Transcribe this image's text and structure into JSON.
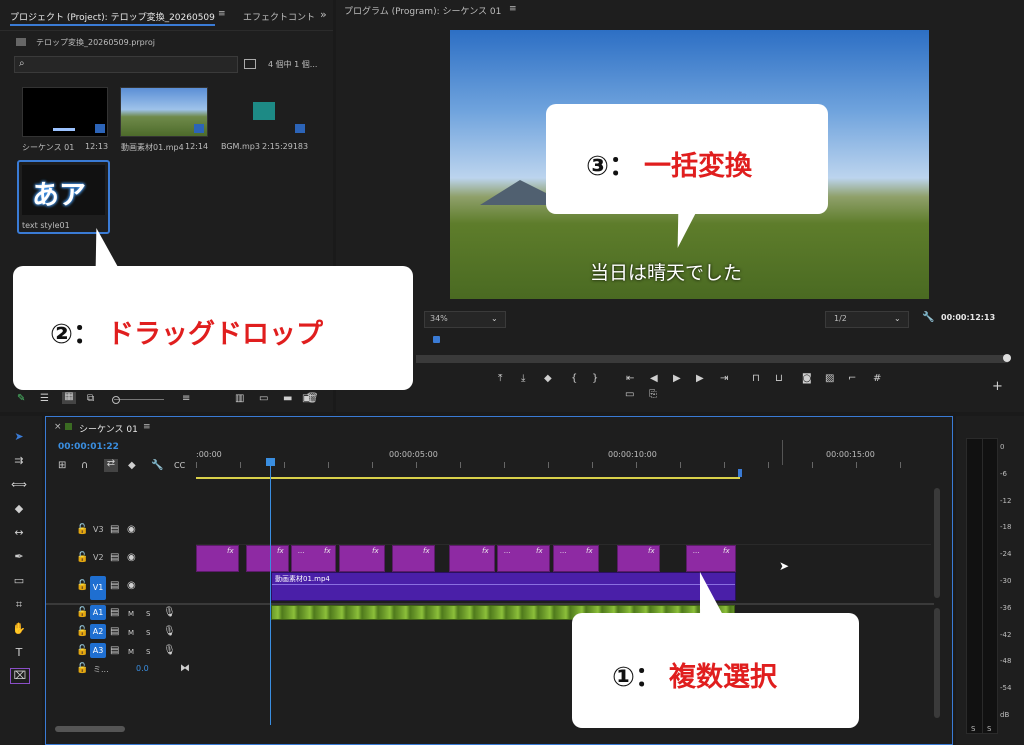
{
  "project_panel": {
    "tab_project": "プロジェクト (Project): テロップ変換_20260509",
    "tab_menu_icon": "≡",
    "tab_effects": "エフェクトコント",
    "overflow_icon": "»",
    "file_name": "テロップ変換_20260509.prproj",
    "item_count": "4 個中 1 個...",
    "items": [
      {
        "name": "シーケンス 01",
        "duration": "12:13"
      },
      {
        "name": "動画素材01.mp4",
        "duration": "12:14"
      },
      {
        "name": "BGM.mp3",
        "duration": "2:15:29183"
      },
      {
        "name": "text style01",
        "duration": ""
      }
    ],
    "text_style_thumb": "あア"
  },
  "program_monitor": {
    "title": "プログラム (Program): シーケンス 01",
    "menu_icon": "≡",
    "subtitle": "当日は晴天でした",
    "zoom": "34%",
    "resolution": "1/2",
    "timecode": "00:00:12:13"
  },
  "timeline": {
    "tab_title": "シーケンス 01",
    "menu_icon": "≡",
    "current_time": "00:00:01:22",
    "ruler": [
      ":00:00",
      "00:00:05:00",
      "00:00:10:00",
      "00:00:15:00"
    ],
    "tracks": [
      {
        "label": "V3"
      },
      {
        "label": "V2"
      },
      {
        "label": "V1"
      },
      {
        "label": "A1"
      },
      {
        "label": "A2"
      },
      {
        "label": "A3"
      }
    ],
    "mix_label": "ミ...",
    "mix_value": "0.0",
    "v1_clip": "動画素材01.mp4",
    "fx_label": "fx",
    "ellipsis": "...",
    "m_label": "M",
    "s_label": "S"
  },
  "meter_scale": [
    "0",
    "-6",
    "-12",
    "-18",
    "-24",
    "-30",
    "-36",
    "-42",
    "-48",
    "-54",
    "dB"
  ],
  "meter_bottom": [
    "S",
    "S"
  ],
  "callouts": {
    "c1_prefix": "①：",
    "c1_text": "複数選択",
    "c2_prefix": "②：",
    "c2_text": "ドラッグドロップ",
    "c3_prefix": "③：",
    "c3_text": "一括変換"
  },
  "colors": {
    "accent_blue": "#1f6fd1",
    "clip_purple": "#8e2aa3",
    "callout_red": "#e01e1e",
    "audio_green": "#6b9a2a"
  }
}
